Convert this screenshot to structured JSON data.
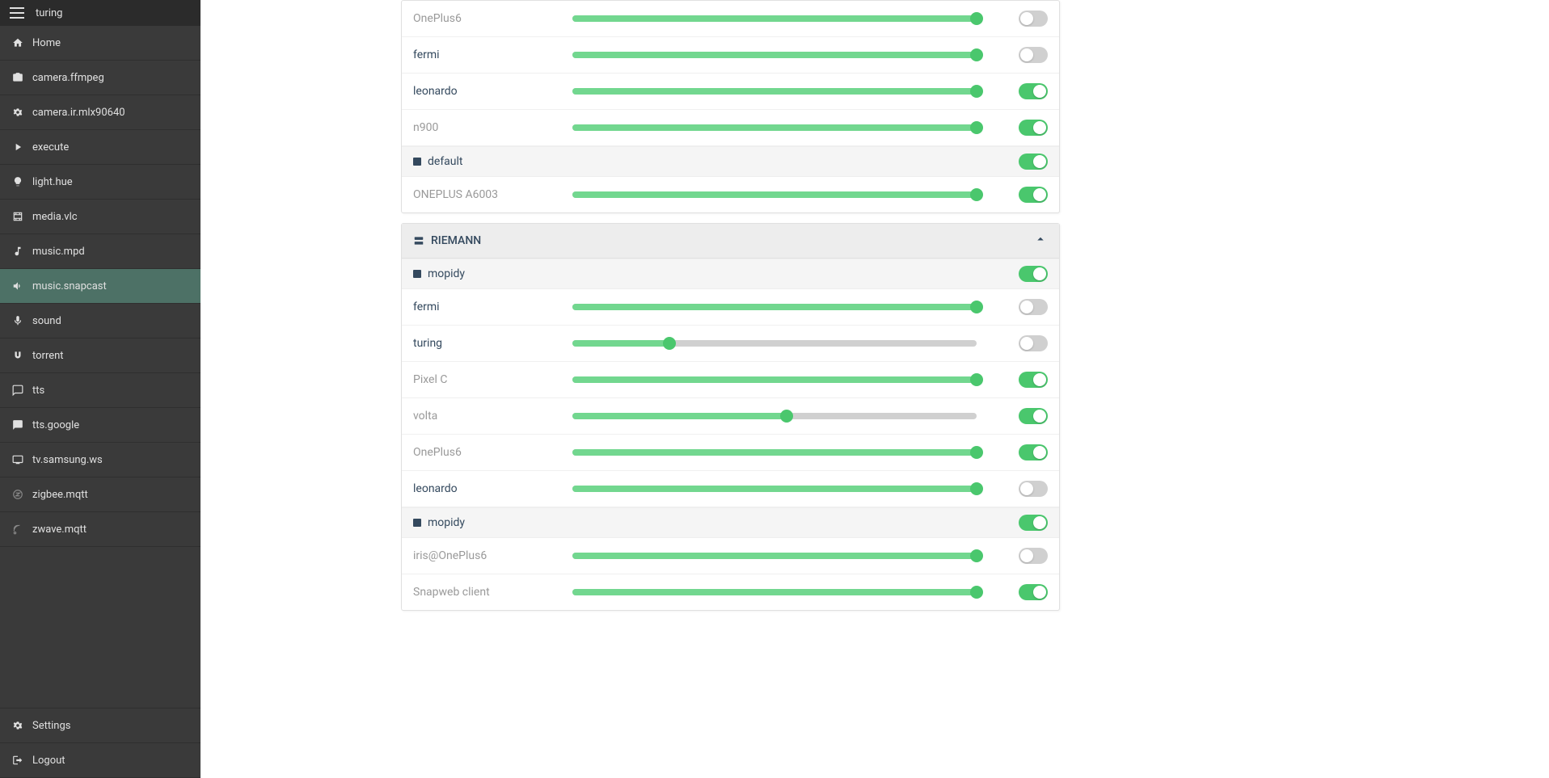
{
  "header": {
    "title": "turing"
  },
  "sidebar": {
    "items": [
      {
        "label": "Home",
        "icon": "home",
        "active": false
      },
      {
        "label": "camera.ffmpeg",
        "icon": "camera",
        "active": false
      },
      {
        "label": "camera.ir.mlx90640",
        "icon": "gear",
        "active": false
      },
      {
        "label": "execute",
        "icon": "play",
        "active": false
      },
      {
        "label": "light.hue",
        "icon": "bulb",
        "active": false
      },
      {
        "label": "media.vlc",
        "icon": "film",
        "active": false
      },
      {
        "label": "music.mpd",
        "icon": "music",
        "active": false
      },
      {
        "label": "music.snapcast",
        "icon": "speaker",
        "active": true
      },
      {
        "label": "sound",
        "icon": "mic",
        "active": false
      },
      {
        "label": "torrent",
        "icon": "magnet",
        "active": false
      },
      {
        "label": "tts",
        "icon": "chat",
        "active": false
      },
      {
        "label": "tts.google",
        "icon": "chat-fill",
        "active": false
      },
      {
        "label": "tv.samsung.ws",
        "icon": "tv",
        "active": false
      },
      {
        "label": "zigbee.mqtt",
        "icon": "zigbee",
        "active": false,
        "dim": true
      },
      {
        "label": "zwave.mqtt",
        "icon": "zwave",
        "active": false,
        "dim": true
      }
    ],
    "footer": [
      {
        "label": "Settings",
        "icon": "gear"
      },
      {
        "label": "Logout",
        "icon": "logout"
      }
    ]
  },
  "panels": [
    {
      "title": null,
      "groups": [
        {
          "label": null,
          "rows": [
            {
              "label": "OnePlus6",
              "dim": true,
              "volume": 100,
              "toggle": false
            },
            {
              "label": "fermi",
              "dim": false,
              "volume": 100,
              "toggle": false
            },
            {
              "label": "leonardo",
              "dim": false,
              "volume": 100,
              "toggle": true
            },
            {
              "label": "n900",
              "dim": true,
              "volume": 100,
              "toggle": true
            }
          ]
        },
        {
          "label": "default",
          "toggle": true,
          "rows": [
            {
              "label": "ONEPLUS A6003",
              "dim": true,
              "volume": 100,
              "toggle": true
            }
          ]
        }
      ]
    },
    {
      "title": "RIEMANN",
      "groups": [
        {
          "label": "mopidy",
          "toggle": true,
          "rows": [
            {
              "label": "fermi",
              "dim": false,
              "volume": 100,
              "toggle": false
            },
            {
              "label": "turing",
              "dim": false,
              "volume": 24,
              "toggle": false
            },
            {
              "label": "Pixel C",
              "dim": true,
              "volume": 100,
              "toggle": true
            },
            {
              "label": "volta",
              "dim": true,
              "volume": 53,
              "toggle": true
            },
            {
              "label": "OnePlus6",
              "dim": true,
              "volume": 100,
              "toggle": true
            },
            {
              "label": "leonardo",
              "dim": false,
              "volume": 100,
              "toggle": false
            }
          ]
        },
        {
          "label": "mopidy",
          "toggle": true,
          "rows": [
            {
              "label": "iris@OnePlus6",
              "dim": true,
              "volume": 100,
              "toggle": false
            },
            {
              "label": "Snapweb client",
              "dim": true,
              "volume": 100,
              "toggle": true
            }
          ]
        }
      ]
    }
  ]
}
